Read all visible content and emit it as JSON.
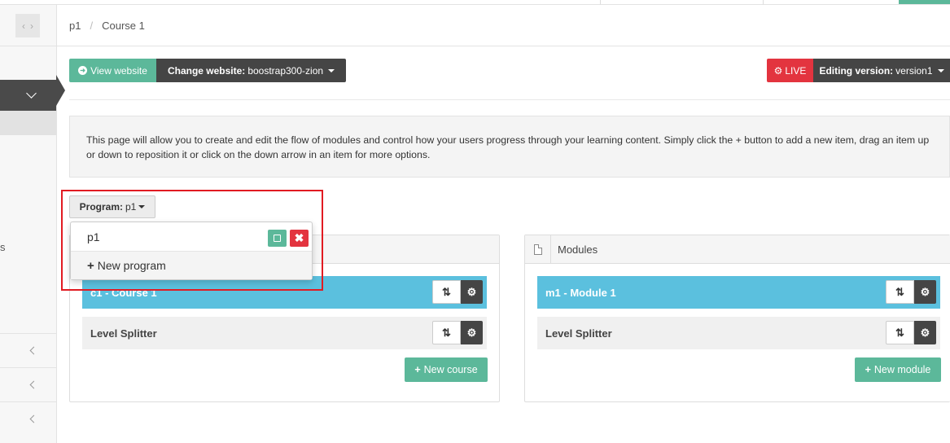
{
  "breadcrumb": {
    "items": [
      "p1",
      "Course 1"
    ],
    "separator": "/"
  },
  "sidebar": {
    "letter": "s"
  },
  "toolbar": {
    "view_website": "View website",
    "change_website_label": "Change website:",
    "change_website_value": "boostrap300-zion",
    "live_label": "LIVE",
    "editing_version_label": "Editing version:",
    "editing_version_value": "version1"
  },
  "info": {
    "text": "This page will allow you to create and edit the flow of modules and control how your users progress through your learning content. Simply click the + button to add a new item, drag an item up or down to reposition it or click on the down arrow in an item for more options."
  },
  "program": {
    "label": "Program:",
    "value": "p1"
  },
  "dropdown": {
    "items": [
      {
        "label": "p1"
      }
    ],
    "new_program": "New program"
  },
  "courses_panel": {
    "title": "",
    "items": [
      {
        "label": "c1 - Course 1",
        "highlighted": true
      },
      {
        "label": "Level Splitter",
        "highlighted": false
      }
    ],
    "new_button": "New course"
  },
  "modules_panel": {
    "title": "Modules",
    "items": [
      {
        "label": "m1 - Module 1",
        "highlighted": true
      },
      {
        "label": "Level Splitter",
        "highlighted": false
      }
    ],
    "new_button": "New module"
  },
  "colors": {
    "green": "#5cb89a",
    "red": "#e3343f",
    "dark": "#454545",
    "blue": "#5bc0de",
    "highlight": "#e11b22"
  },
  "icons": {
    "plus": "+",
    "sort": "⇅",
    "gear": "⚙",
    "close": "✖",
    "arrow_right": "➜"
  }
}
